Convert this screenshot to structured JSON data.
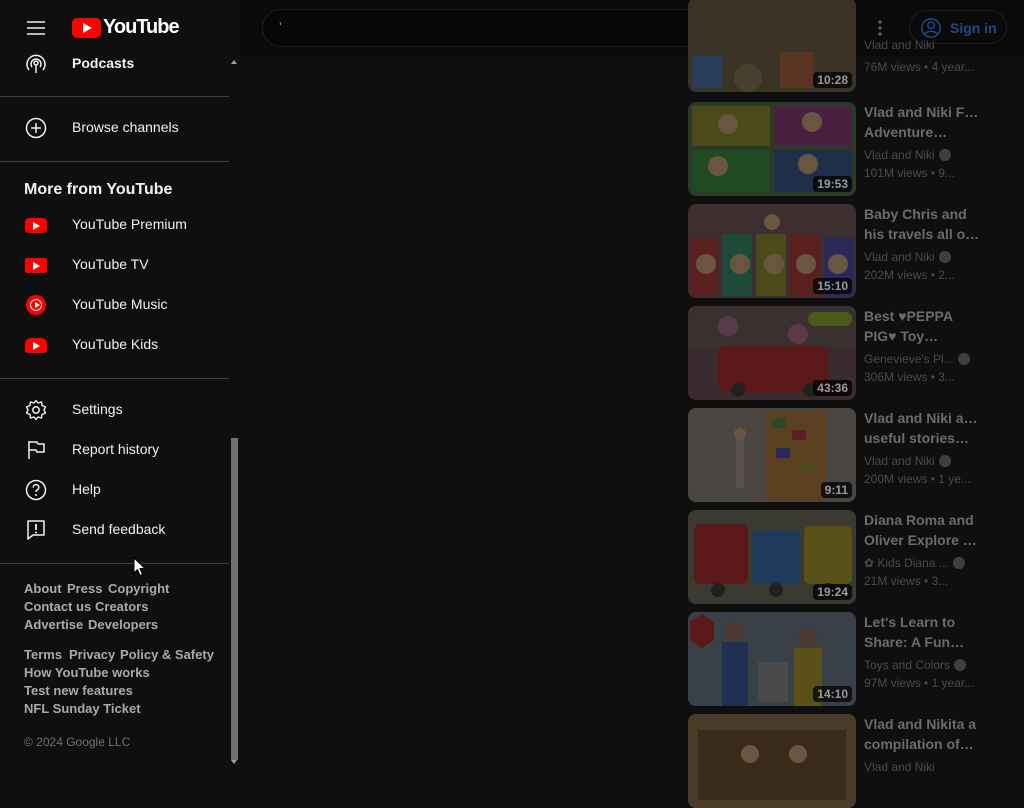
{
  "brand": {
    "logo_text": "YouTube"
  },
  "search": {
    "query": "'"
  },
  "header": {
    "signin_label": "Sign in"
  },
  "sidebar": {
    "podcasts_label": "Podcasts",
    "browse_channels_label": "Browse channels",
    "more_from_title": "More from YouTube",
    "more_from": [
      {
        "label": "YouTube Premium",
        "icon": "youtube-premium-icon"
      },
      {
        "label": "YouTube TV",
        "icon": "youtube-tv-icon"
      },
      {
        "label": "YouTube Music",
        "icon": "youtube-music-icon"
      },
      {
        "label": "YouTube Kids",
        "icon": "youtube-kids-icon"
      }
    ],
    "settings": [
      {
        "label": "Settings",
        "icon": "gear-icon"
      },
      {
        "label": "Report history",
        "icon": "flag-icon"
      },
      {
        "label": "Help",
        "icon": "help-icon"
      },
      {
        "label": "Send feedback",
        "icon": "feedback-icon"
      }
    ],
    "footer_links_1": [
      "About",
      "Press",
      "Copyright",
      "Contact us",
      "Creators",
      "Advertise",
      "Developers"
    ],
    "footer_links_2": [
      "Terms",
      "Privacy",
      "Policy & Safety",
      "How YouTube works",
      "Test new features",
      "NFL Sunday Ticket"
    ],
    "copyright": "© 2024 Google LLC"
  },
  "related_videos": [
    {
      "title_line1": "",
      "title_line2": "Vlad and Niki",
      "channel": "",
      "views": "76M views",
      "age": "4 year...",
      "duration": "10:28"
    },
    {
      "title_line1": "Vlad and Niki Fun",
      "title_line2": "Adventure…",
      "channel": "Vlad and Niki",
      "views": "101M views",
      "age": "9...",
      "duration": "19:53"
    },
    {
      "title_line1": "Baby Chris and",
      "title_line2": "his travels all ov…",
      "channel": "Vlad and Niki",
      "views": "202M views",
      "age": "2...",
      "duration": "15:10"
    },
    {
      "title_line1": "Best ♥PEPPA",
      "title_line2": "PIG♥ Toy…",
      "channel": "Genevieve's Pl...",
      "views": "306M views",
      "age": "3...",
      "duration": "43:36"
    },
    {
      "title_line1": "Vlad and Niki and",
      "title_line2": "useful stories…",
      "channel": "Vlad and Niki",
      "views": "200M views",
      "age": "1 ye...",
      "duration": "9:11"
    },
    {
      "title_line1": "Diana Roma and",
      "title_line2": "Oliver Explore th…",
      "channel": "✿ Kids Diana ...",
      "views": "21M views",
      "age": "3...",
      "duration": "19:24"
    },
    {
      "title_line1": "Let's Learn to",
      "title_line2": "Share: A Fun…",
      "channel": "Toys and Colors",
      "views": "97M views",
      "age": "1 year...",
      "duration": "14:10"
    },
    {
      "title_line1": "Vlad and Nikita a",
      "title_line2": "compilation of…",
      "channel": "Vlad and Niki",
      "views": "",
      "age": "",
      "duration": ""
    }
  ],
  "colors": {
    "thumb_1": "#3a3427",
    "thumb_2": "#2b3a26",
    "thumb_3": "#3d2f2f",
    "thumb_4": "#3b2b2e",
    "thumb_5": "#3f3630",
    "thumb_6": "#2e2f3c",
    "thumb_7": "#353a40",
    "thumb_8": "#3b3328"
  }
}
